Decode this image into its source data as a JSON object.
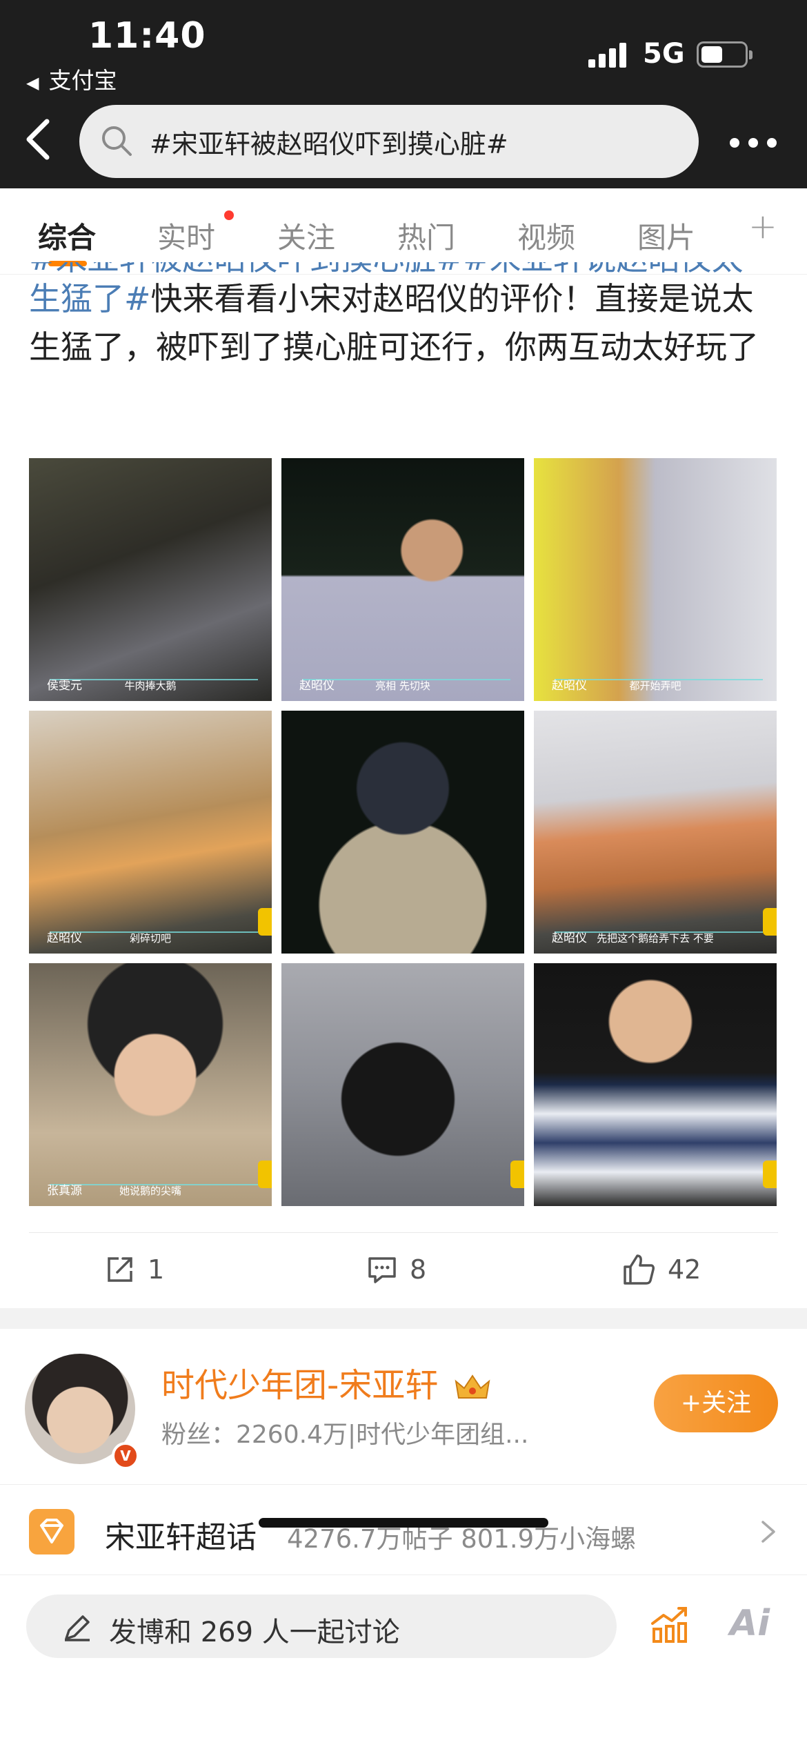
{
  "status_bar": {
    "time": "11:40",
    "back_app": "支付宝",
    "network": "5G"
  },
  "search": {
    "query": "#宋亚轩被赵昭仪吓到摸心脏#"
  },
  "tabs": [
    {
      "label": "综合",
      "active": true
    },
    {
      "label": "实时",
      "active": false,
      "dot": true
    },
    {
      "label": "关注",
      "active": false
    },
    {
      "label": "热门",
      "active": false
    },
    {
      "label": "视频",
      "active": false
    },
    {
      "label": "图片",
      "active": false
    }
  ],
  "post": {
    "cut_line": "#宋亚轩被赵昭仪吓到摸心脏##宋亚轩说赵昭仪太",
    "tag_tail": "生猛了#",
    "text": "快来看看小宋对赵昭仪的评价！直接是说太生猛了，被吓到了摸心脏可还行，你两互动太好玩了",
    "images": [
      {
        "caption_name": "侯雯元",
        "caption_text": "牛肉捧大鹅"
      },
      {
        "caption_name": "赵昭仪",
        "caption_text": "亮相 先切块"
      },
      {
        "caption_name": "赵昭仪",
        "caption_text": "都开始弄吧"
      },
      {
        "caption_name": "赵昭仪",
        "caption_text": "剁碎切吧"
      },
      {
        "caption_name": "",
        "caption_text": ""
      },
      {
        "caption_name": "赵昭仪",
        "caption_text": "先把这个鹅给弄下去 不要"
      },
      {
        "caption_name": "张真源",
        "caption_text": "她说鹅的尖嘴"
      },
      {
        "caption_name": "",
        "caption_text": ""
      },
      {
        "caption_name": "",
        "caption_text": ""
      }
    ]
  },
  "actions": {
    "repost_count": "1",
    "comment_count": "8",
    "like_count": "42"
  },
  "author": {
    "name": "时代少年团-宋亚轩",
    "fans": "粉丝：2260.4万|时代少年团组...",
    "follow_label": "+关注",
    "verified_mark": "V"
  },
  "super_topic": {
    "name": "宋亚轩超话",
    "stats": "4276.7万帖子  801.9万小海螺"
  },
  "compose": {
    "placeholder": "发博和 269 人一起讨论",
    "ai_label": "Ai"
  },
  "colors": {
    "accent": "#ff8200",
    "link": "#4b7db5",
    "author_name": "#f07c1c"
  }
}
